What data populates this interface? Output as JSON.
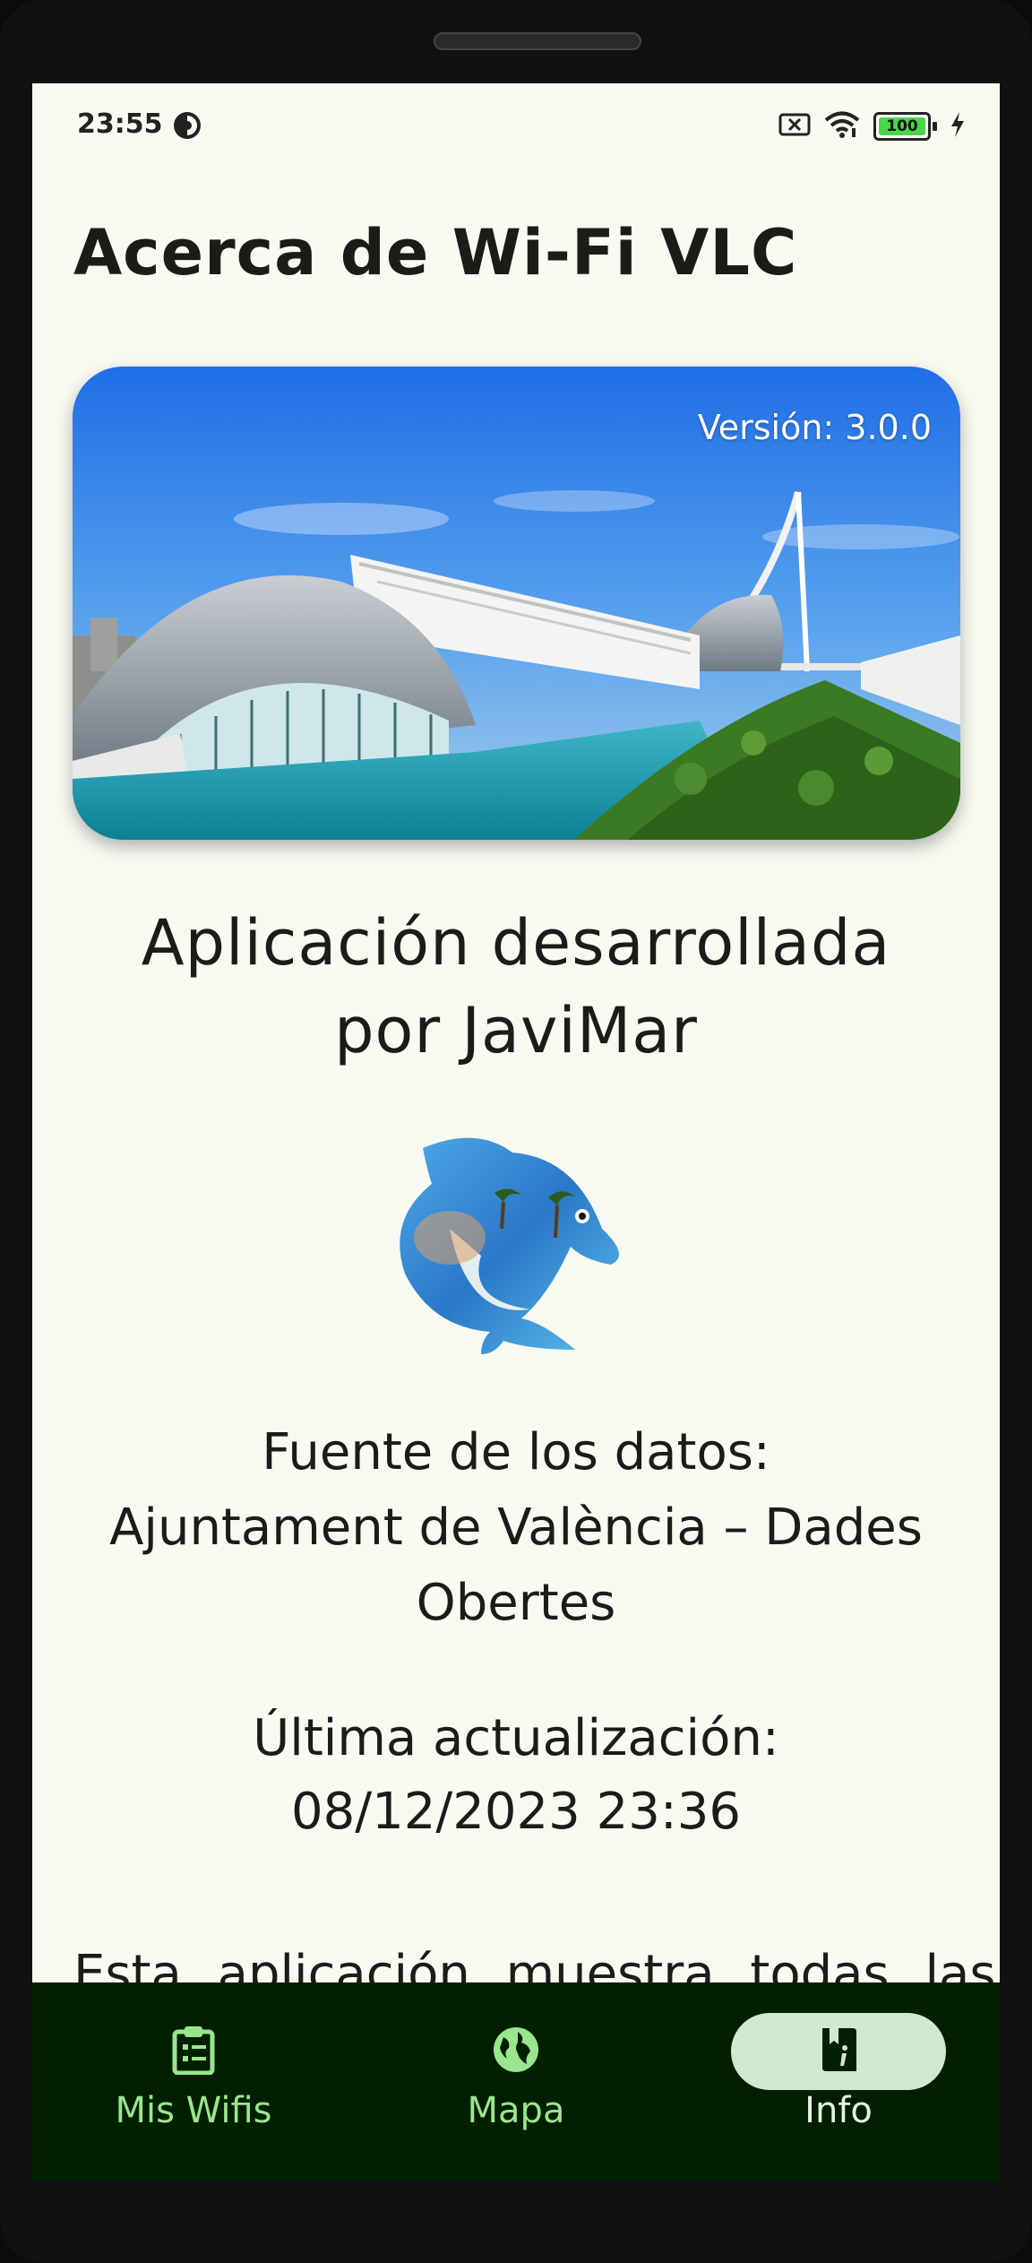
{
  "status_bar": {
    "time": "23:55",
    "battery": "100"
  },
  "page_title": "Acerca de Wi-Fi VLC",
  "hero": {
    "version": "Versión: 3.0.0"
  },
  "developer": {
    "line1": "Aplicación desarrollada",
    "line2": "por JaviMar"
  },
  "data_source": {
    "line1": "Fuente de los datos:",
    "line2": "Ajuntament de València – Dades",
    "line3": "Obertes"
  },
  "last_update": {
    "line1": "Última actualización:",
    "line2": "08/12/2023 23:36"
  },
  "description": "Esta aplicación muestra todas las",
  "bottom_nav": {
    "items": [
      {
        "label": "Mis Wifis",
        "icon": "clipboard-list-icon",
        "active": false
      },
      {
        "label": "Mapa",
        "icon": "globe-icon",
        "active": false
      },
      {
        "label": "Info",
        "icon": "book-info-icon",
        "active": true
      }
    ]
  },
  "colors": {
    "background": "#f8f9f1",
    "nav_background": "#012000",
    "nav_active_pill": "#d3e8d0",
    "nav_label": "#9be58f"
  }
}
